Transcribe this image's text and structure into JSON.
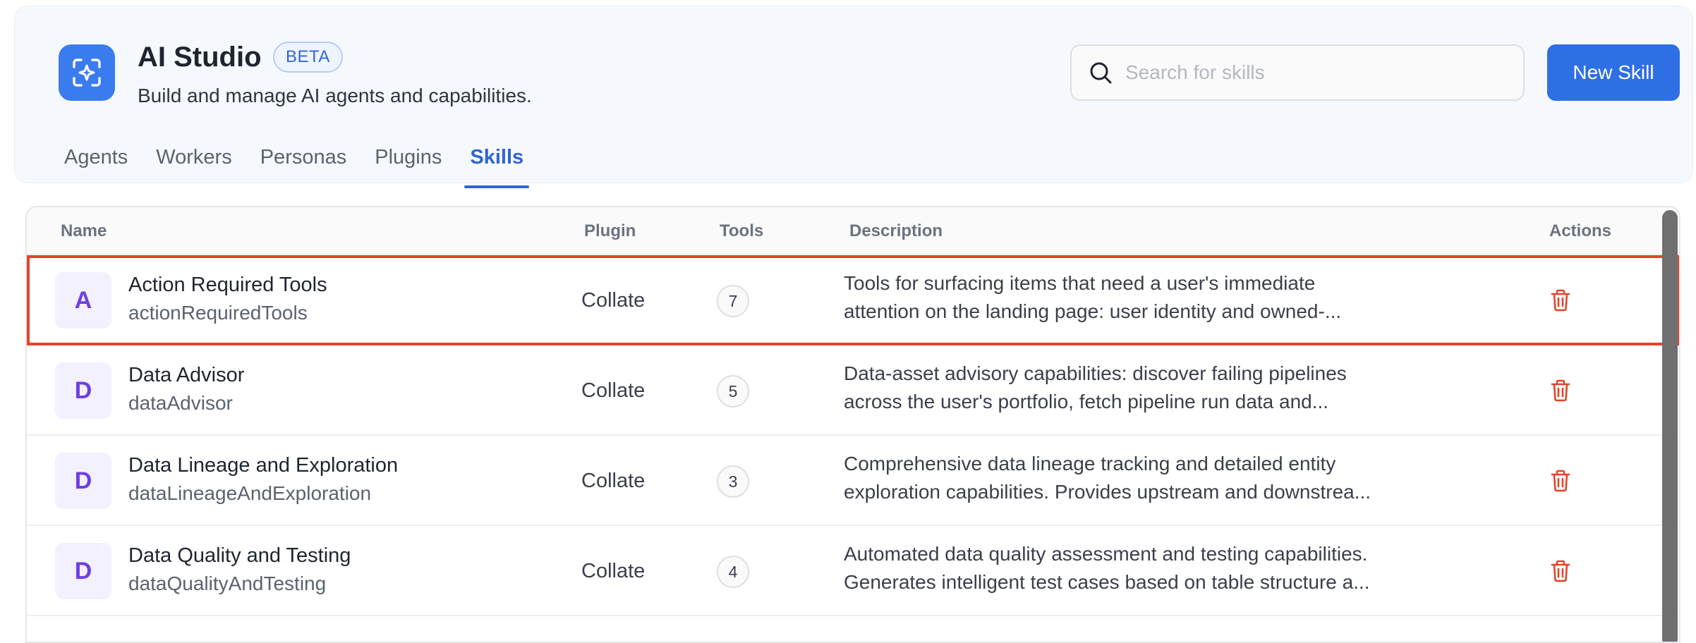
{
  "header": {
    "title": "AI Studio",
    "badge": "BETA",
    "subtitle": "Build and manage AI agents and capabilities.",
    "logo_icon": "ai-sparkle-icon",
    "search": {
      "placeholder": "Search for skills",
      "value": ""
    },
    "new_button_label": "New Skill",
    "accent_color": "#2f6fe4"
  },
  "tabs": [
    {
      "label": "Agents",
      "active": false
    },
    {
      "label": "Workers",
      "active": false
    },
    {
      "label": "Personas",
      "active": false
    },
    {
      "label": "Plugins",
      "active": false
    },
    {
      "label": "Skills",
      "active": true
    }
  ],
  "table": {
    "columns": {
      "name": "Name",
      "plugin": "Plugin",
      "tools": "Tools",
      "description": "Description",
      "actions": "Actions"
    },
    "rows": [
      {
        "initial": "A",
        "name": "Action Required Tools",
        "id": "actionRequiredTools",
        "plugin": "Collate",
        "tools": "7",
        "description_line1": "Tools for surfacing items that need a user's immediate",
        "description_line2": "attention on the landing page: user identity and owned-...",
        "highlighted": true
      },
      {
        "initial": "D",
        "name": "Data Advisor",
        "id": "dataAdvisor",
        "plugin": "Collate",
        "tools": "5",
        "description_line1": "Data-asset advisory capabilities: discover failing pipelines",
        "description_line2": "across the user's portfolio, fetch pipeline run data and...",
        "highlighted": false
      },
      {
        "initial": "D",
        "name": "Data Lineage and Exploration",
        "id": "dataLineageAndExploration",
        "plugin": "Collate",
        "tools": "3",
        "description_line1": "Comprehensive data lineage tracking and detailed entity",
        "description_line2": "exploration capabilities. Provides upstream and downstrea...",
        "highlighted": false
      },
      {
        "initial": "D",
        "name": "Data Quality and Testing",
        "id": "dataQualityAndTesting",
        "plugin": "Collate",
        "tools": "4",
        "description_line1": "Automated data quality assessment and testing capabilities.",
        "description_line2": "Generates intelligent test cases based on table structure a...",
        "highlighted": false
      }
    ],
    "delete_icon": "trash-icon",
    "delete_color": "#e2452a",
    "highlight_color": "#e2452a"
  }
}
